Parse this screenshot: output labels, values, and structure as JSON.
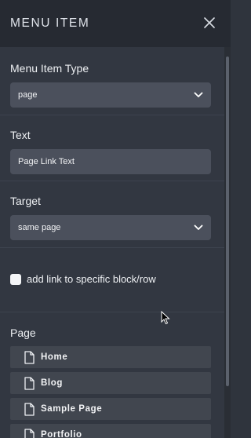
{
  "header": {
    "title": "MENU ITEM"
  },
  "menu_item_type": {
    "label": "Menu Item Type",
    "value": "page"
  },
  "text": {
    "label": "Text",
    "value": "Page Link Text"
  },
  "target": {
    "label": "Target",
    "value": "same page"
  },
  "specific_block": {
    "label": "add link to specific block/row",
    "checked": false
  },
  "page": {
    "label": "Page",
    "items": [
      {
        "label": "Home"
      },
      {
        "label": "Blog"
      },
      {
        "label": "Sample Page"
      },
      {
        "label": "Portfolio"
      }
    ]
  }
}
